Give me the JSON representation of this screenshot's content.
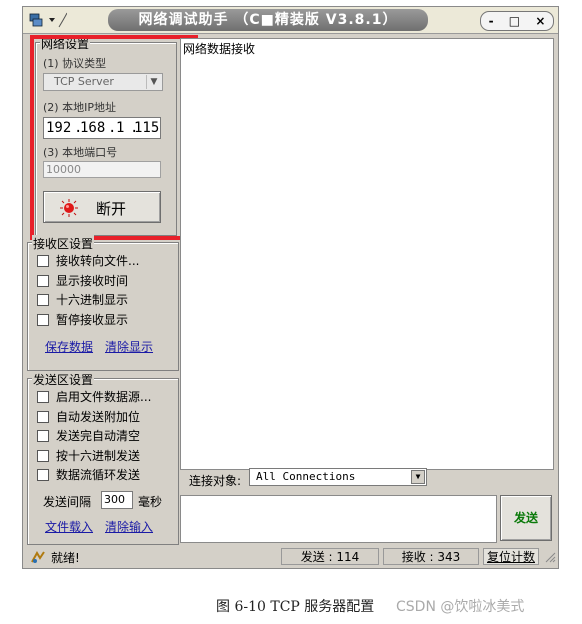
{
  "window": {
    "title": "网络调试助手 （C■精装版 V3.8.1）",
    "min_btn": "-",
    "max_btn": "□",
    "close_btn": "×"
  },
  "net_settings": {
    "group_label": "网络设置",
    "protocol_label": "(1) 协议类型",
    "protocol_value": "TCP Server",
    "local_ip_label": "(2) 本地IP地址",
    "ip": [
      "192",
      "168",
      "1",
      "115"
    ],
    "port_label": "(3) 本地端口号",
    "port_value": "10000",
    "disconnect_label": "断开",
    "highlight_color": "#e8202a"
  },
  "recv_settings": {
    "group_label": "接收区设置",
    "options": [
      "接收转向文件...",
      "显示接收时间",
      "十六进制显示",
      "暂停接收显示"
    ],
    "save_link": "保存数据",
    "clear_link": "清除显示"
  },
  "send_settings": {
    "group_label": "发送区设置",
    "options": [
      "启用文件数据源...",
      "自动发送附加位",
      "发送完自动清空",
      "按十六进制发送",
      "数据流循环发送"
    ],
    "interval_label": "发送间隔",
    "interval_value": "300",
    "interval_unit": "毫秒",
    "load_file_link": "文件载入",
    "clear_input_link": "清除输入"
  },
  "recv_panel": {
    "title": "网络数据接收"
  },
  "connect": {
    "label": "连接对象:",
    "value": "All Connections"
  },
  "send_button": "发送",
  "status": {
    "ready": "就绪!",
    "sent": "发送 : 114",
    "received": "接收 : 343",
    "reset": "复位计数"
  },
  "caption": "图 6-10 TCP 服务器配置",
  "watermark": "CSDN @饮啦冰美式"
}
